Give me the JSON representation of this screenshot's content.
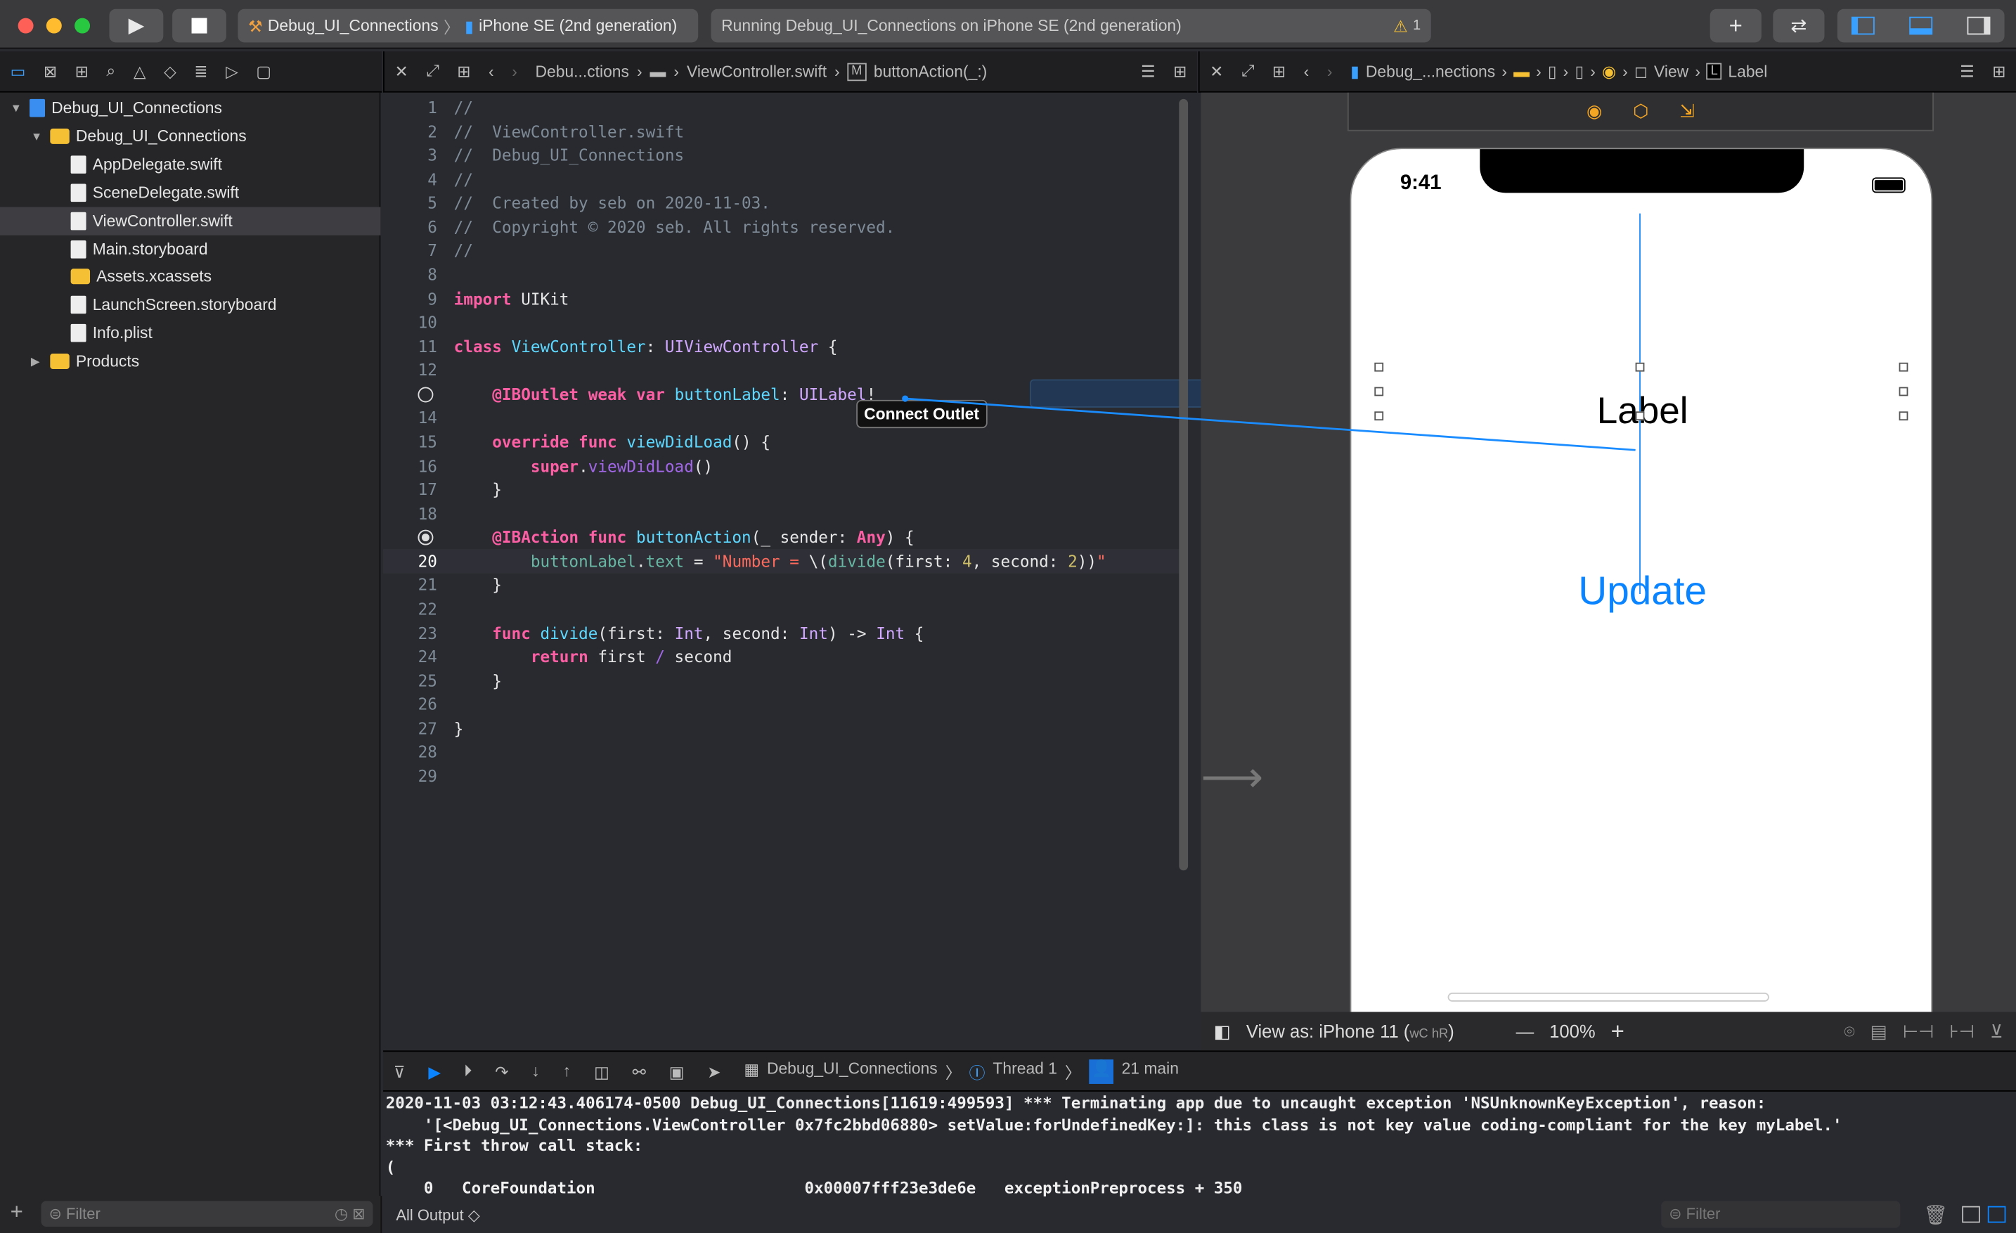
{
  "toolbar": {
    "scheme": "Debug_UI_Connections",
    "device": "iPhone SE (2nd generation)",
    "status": "Running Debug_UI_Connections on iPhone SE (2nd generation)",
    "warning_count": "1"
  },
  "navigator": {
    "items": [
      {
        "label": "Debug_UI_Connections",
        "type": "project",
        "level": 0,
        "expanded": true
      },
      {
        "label": "Debug_UI_Connections",
        "type": "folder",
        "level": 1,
        "expanded": true
      },
      {
        "label": "AppDelegate.swift",
        "type": "file",
        "level": 2
      },
      {
        "label": "SceneDelegate.swift",
        "type": "file",
        "level": 2
      },
      {
        "label": "ViewController.swift",
        "type": "file",
        "level": 2,
        "selected": true
      },
      {
        "label": "Main.storyboard",
        "type": "file",
        "level": 2
      },
      {
        "label": "Assets.xcassets",
        "type": "folder",
        "level": 2
      },
      {
        "label": "LaunchScreen.storyboard",
        "type": "file",
        "level": 2
      },
      {
        "label": "Info.plist",
        "type": "file",
        "level": 2
      },
      {
        "label": "Products",
        "type": "folder",
        "level": 1,
        "expanded": false
      }
    ],
    "filter_placeholder": "Filter"
  },
  "editor": {
    "breadcrumb": [
      "Debu...ctions",
      "ViewController.swift",
      "buttonAction(_:)"
    ],
    "current_line": 20,
    "lines": [
      [
        [
          "cm",
          "//"
        ]
      ],
      [
        [
          "cm",
          "//  ViewController.swift"
        ]
      ],
      [
        [
          "cm",
          "//  Debug_UI_Connections"
        ]
      ],
      [
        [
          "cm",
          "//"
        ]
      ],
      [
        [
          "cm",
          "//  Created by seb on 2020-11-03."
        ]
      ],
      [
        [
          "cm",
          "//  Copyright © 2020 seb. All rights reserved."
        ]
      ],
      [
        [
          "cm",
          "//"
        ]
      ],
      [],
      [
        [
          "kw",
          "import"
        ],
        [
          "pl",
          " UIKit"
        ]
      ],
      [],
      [
        [
          "kw",
          "class"
        ],
        [
          "pl",
          " "
        ],
        [
          "dc",
          "ViewController"
        ],
        [
          "pl",
          ": "
        ],
        [
          "ty",
          "UIViewController"
        ],
        [
          "pl",
          " {"
        ]
      ],
      [],
      [
        [
          "pl",
          "    "
        ],
        [
          "kw",
          "@IBOutlet weak"
        ],
        [
          "pl",
          " "
        ],
        [
          "kw",
          "var"
        ],
        [
          "pl",
          " "
        ],
        [
          "dc",
          "buttonLabel"
        ],
        [
          "pl",
          ": "
        ],
        [
          "ty",
          "UILabel"
        ],
        [
          "pl",
          "!"
        ]
      ],
      [],
      [
        [
          "pl",
          "    "
        ],
        [
          "kw",
          "override func"
        ],
        [
          "pl",
          " "
        ],
        [
          "dc",
          "viewDidLoad"
        ],
        [
          "pl",
          "() {"
        ]
      ],
      [
        [
          "pl",
          "        "
        ],
        [
          "kw",
          "super"
        ],
        [
          "pl",
          "."
        ],
        [
          "sc",
          "viewDidLoad"
        ],
        [
          "pl",
          "()"
        ]
      ],
      [
        [
          "pl",
          "    }"
        ]
      ],
      [],
      [
        [
          "pl",
          "    "
        ],
        [
          "kw",
          "@IBAction func"
        ],
        [
          "pl",
          " "
        ],
        [
          "dc",
          "buttonAction"
        ],
        [
          "pl",
          "(_ sender: "
        ],
        [
          "kw",
          "Any"
        ],
        [
          "pl",
          ") {"
        ]
      ],
      [
        [
          "pl",
          "        "
        ],
        [
          "fn",
          "buttonLabel"
        ],
        [
          "pl",
          "."
        ],
        [
          "fn",
          "text"
        ],
        [
          "pl",
          " = "
        ],
        [
          "st",
          "\"Number = "
        ],
        [
          "pl",
          "\\("
        ],
        [
          "fn",
          "divide"
        ],
        [
          "pl",
          "(first: "
        ],
        [
          "nu",
          "4"
        ],
        [
          "pl",
          ", second: "
        ],
        [
          "nu",
          "2"
        ],
        [
          "pl",
          "))"
        ],
        [
          "st",
          "\""
        ]
      ],
      [
        [
          "pl",
          "    }"
        ]
      ],
      [],
      [
        [
          "pl",
          "    "
        ],
        [
          "kw",
          "func"
        ],
        [
          "pl",
          " "
        ],
        [
          "dc",
          "divide"
        ],
        [
          "pl",
          "(first: "
        ],
        [
          "ty",
          "Int"
        ],
        [
          "pl",
          ", second: "
        ],
        [
          "ty",
          "Int"
        ],
        [
          "pl",
          ") -> "
        ],
        [
          "ty",
          "Int"
        ],
        [
          "pl",
          " {"
        ]
      ],
      [
        [
          "pl",
          "        "
        ],
        [
          "kw",
          "return"
        ],
        [
          "pl",
          " first "
        ],
        [
          "sc",
          "/"
        ],
        [
          "pl",
          " second"
        ]
      ],
      [
        [
          "pl",
          "    }"
        ]
      ],
      [],
      [
        [
          "pl",
          "}"
        ]
      ],
      [],
      []
    ],
    "tooltip": "Connect Outlet"
  },
  "canvas": {
    "breadcrumb": [
      "Debug_...nections",
      "View",
      "Label"
    ],
    "time": "9:41",
    "label_text": "Label",
    "button_text": "Update",
    "view_as": "View as: iPhone 11 (",
    "view_as_size": "wC hR",
    "view_as_end": ")",
    "zoom": "100%"
  },
  "debug": {
    "breadcrumb": [
      "Debug_UI_Connections",
      "Thread 1",
      "21 main"
    ],
    "console": "2020-11-03 03:12:43.406174-0500 Debug_UI_Connections[11619:499593] *** Terminating app due to uncaught exception 'NSUnknownKeyException', reason:\n    '[<Debug_UI_Connections.ViewController 0x7fc2bbd06880> setValue:forUndefinedKey:]: this class is not key value coding-compliant for the key myLabel.'\n*** First throw call stack:\n(\n    0   CoreFoundation                      0x00007fff23e3de6e   exceptionPreprocess + 350",
    "output_selector": "All Output ◇",
    "filter_placeholder": "Filter"
  },
  "colors": {
    "accent": "#0a84ff",
    "connection": "#1a8cff"
  }
}
